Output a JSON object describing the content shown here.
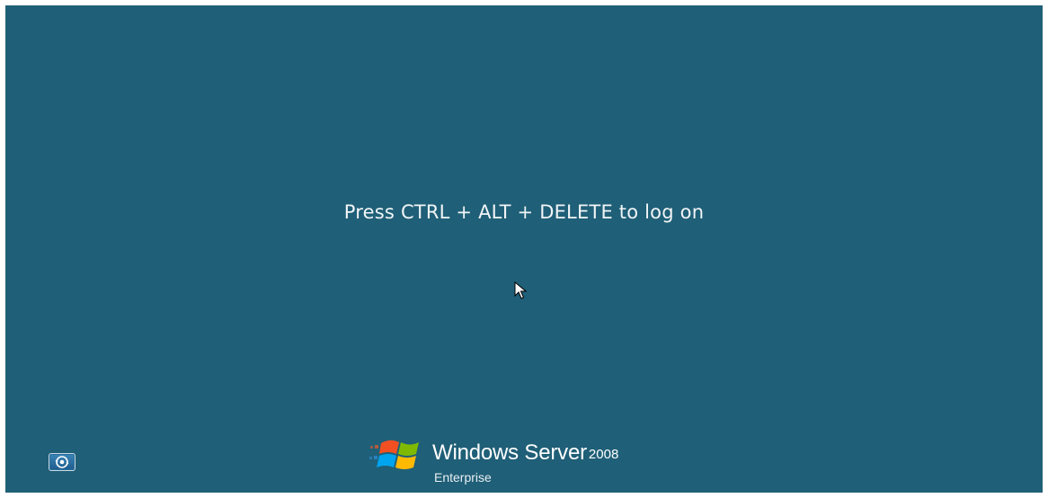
{
  "logon": {
    "prompt": "Press CTRL + ALT + DELETE to log on"
  },
  "ease_of_access": {
    "icon": "ease-of-access-icon"
  },
  "branding": {
    "product": "Windows Server",
    "version": "2008",
    "edition": "Enterprise",
    "logo_icon": "windows-flag-icon"
  },
  "colors": {
    "background": "#1f5f77",
    "text": "#ffffff"
  }
}
